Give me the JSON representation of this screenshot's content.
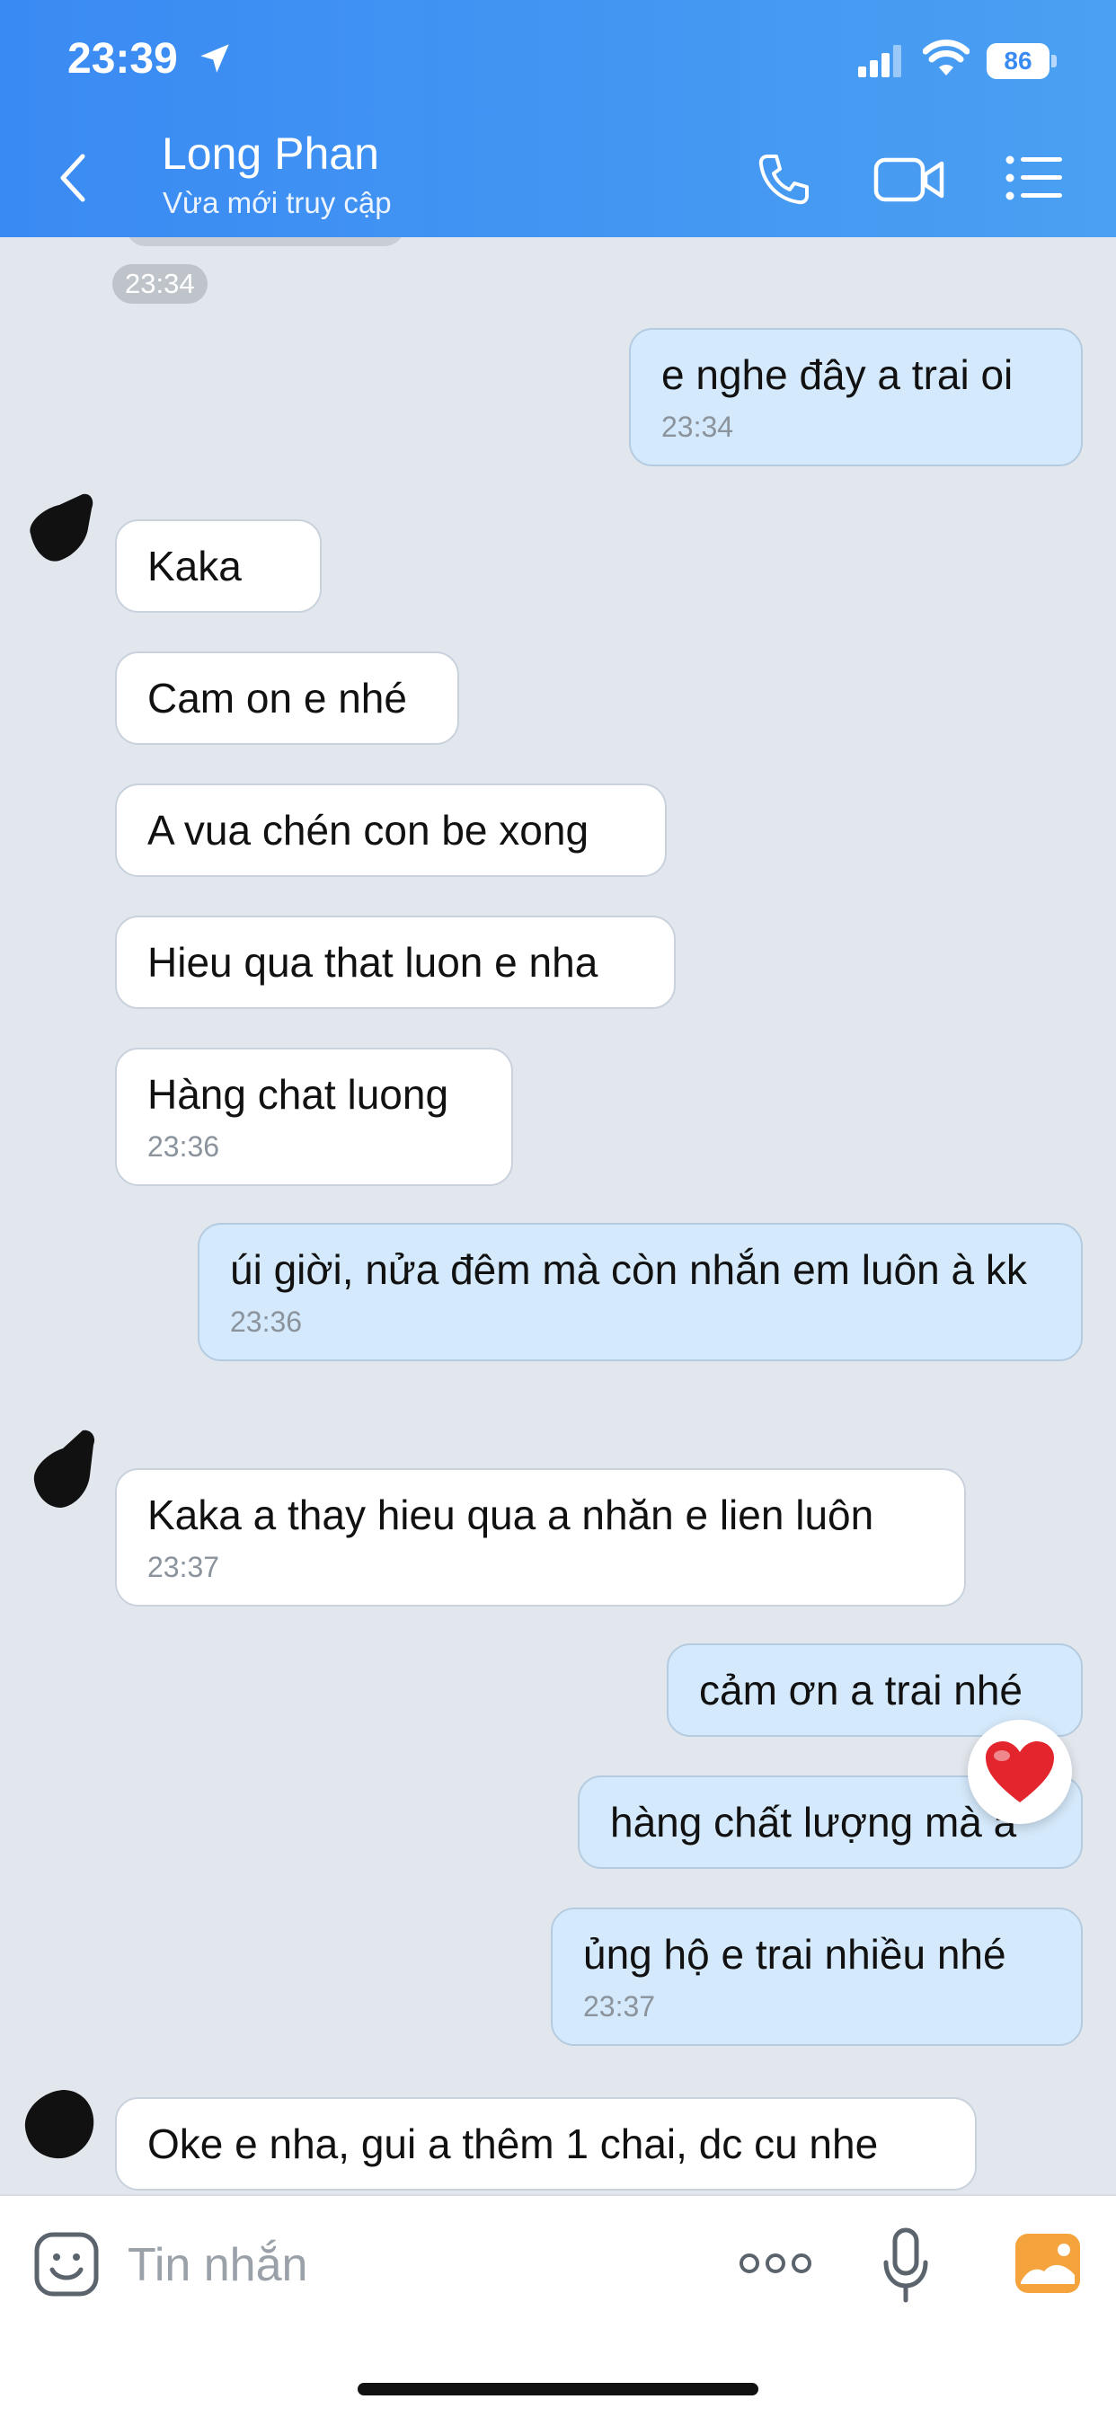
{
  "status_bar": {
    "time": "23:39",
    "battery": "86"
  },
  "header": {
    "contact_name": "Long Phan",
    "contact_status": "Vừa mới truy cập"
  },
  "chat": {
    "first_time": "23:34",
    "messages": [
      {
        "dir": "out",
        "text": "e nghe đây a trai oi",
        "time": "23:34"
      },
      {
        "dir": "in",
        "text": "Kaka"
      },
      {
        "dir": "in",
        "text": "Cam on e nhé"
      },
      {
        "dir": "in",
        "text": "A vua chén con be xong"
      },
      {
        "dir": "in",
        "text": "Hieu qua that luon e nha"
      },
      {
        "dir": "in",
        "text": "Hàng chat luong",
        "time": "23:36"
      },
      {
        "dir": "out",
        "text": "úi giời, nửa đêm mà còn nhắn em luôn à kk",
        "time": "23:36"
      },
      {
        "dir": "in",
        "text": "Kaka a thay hieu qua a nhăn e lien luôn",
        "time": "23:37"
      },
      {
        "dir": "out",
        "text": "cảm ơn a trai nhé"
      },
      {
        "dir": "out",
        "text": "hàng chất lượng mà a"
      },
      {
        "dir": "out",
        "text": "ủng hộ e trai nhiều nhé",
        "time": "23:37"
      },
      {
        "dir": "in",
        "text": "Oke e nha, gui a thêm 1 chai, dc cu nhe"
      }
    ],
    "reaction": "❤️"
  },
  "input_bar": {
    "placeholder": "Tin nhắn"
  },
  "colors": {
    "header": "#3a8af3",
    "outgoing_bubble": "#d4e9fb",
    "incoming_bubble": "#ffffff",
    "background": "#e2e7ee",
    "gallery": "#f5a33c"
  }
}
